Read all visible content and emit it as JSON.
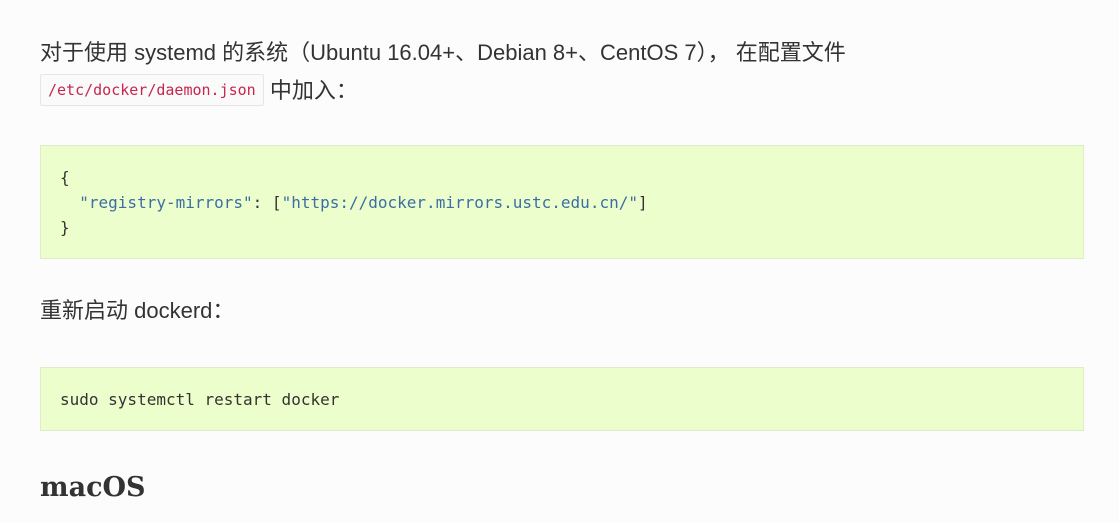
{
  "intro": {
    "text_before": "对于使用 systemd 的系统（Ubuntu 16.04+、Debian 8+、CentOS 7）， 在配置文件",
    "config_path": "/etc/docker/daemon.json",
    "text_after": " 中加入："
  },
  "daemon_json": {
    "line1": "{",
    "line2_indent": "  ",
    "key": "\"registry-mirrors\"",
    "colon": ": [",
    "value": "\"https://docker.mirrors.ustc.edu.cn/\"",
    "close_bracket": "]",
    "line3": "}"
  },
  "restart": {
    "text": "重新启动 dockerd："
  },
  "restart_command": {
    "text": "sudo systemctl restart docker"
  },
  "macos_heading": {
    "text": "macOS"
  }
}
